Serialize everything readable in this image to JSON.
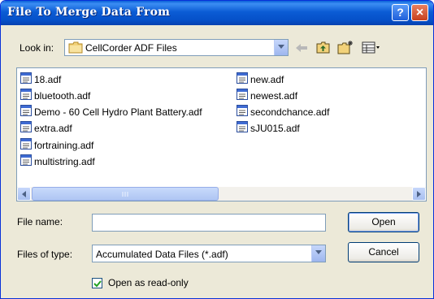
{
  "window": {
    "title": "File To Merge Data From",
    "help_label": "?",
    "close_label": "×"
  },
  "toolbar": {
    "look_in_label": "Look in:",
    "look_in_value": "CellCorder ADF Files",
    "icons": [
      "back-arrow-icon",
      "up-one-level-icon",
      "create-new-folder-icon",
      "view-menu-icon"
    ]
  },
  "files": {
    "column1": [
      "18.adf",
      "bluetooth.adf",
      "Demo - 60 Cell Hydro Plant Battery.adf",
      "extra.adf",
      "fortraining.adf",
      "multistring.adf"
    ],
    "column2": [
      "new.adf",
      "newest.adf",
      "secondchance.adf",
      "sJU015.adf"
    ]
  },
  "form": {
    "file_name_label": "File name:",
    "file_name_value": "",
    "files_of_type_label": "Files of type:",
    "files_of_type_value": "Accumulated Data Files (*.adf)",
    "read_only_label": "Open as read-only",
    "read_only_checked": true
  },
  "buttons": {
    "open": "Open",
    "cancel": "Cancel"
  },
  "colors": {
    "title_bar": "#0A5FD8",
    "dialog_bg": "#ECE9D8",
    "close": "#C8401E"
  }
}
